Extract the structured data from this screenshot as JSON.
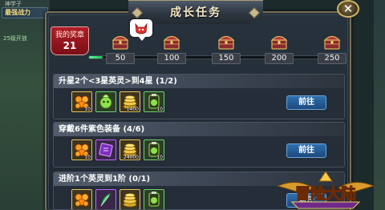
{
  "background": {
    "top_text": "神学子",
    "power_label": "最强战力",
    "hint_text": "25级开放"
  },
  "window": {
    "title": "成长任务",
    "close_symbol": "✕"
  },
  "medal": {
    "label": "我的奖章",
    "value": "21"
  },
  "progress": {
    "current": 21,
    "max": 250,
    "milestones": [
      {
        "value": "50",
        "icon": "chest-icon"
      },
      {
        "value": "100",
        "icon": "chest-icon"
      },
      {
        "value": "150",
        "icon": "chest-icon"
      },
      {
        "value": "200",
        "icon": "chest-icon"
      },
      {
        "value": "250",
        "icon": "chest-icon"
      }
    ]
  },
  "tasks": [
    {
      "title": "升星2个<3星英灵>到4星 (1/2)",
      "button": "前往",
      "rewards": [
        {
          "icon": "orange-gems-icon",
          "count": "10",
          "rarity": "gold"
        },
        {
          "icon": "green-spirit-icon",
          "count": "",
          "rarity": "green"
        },
        {
          "icon": "gold-coins-icon",
          "count": "1400",
          "rarity": "gold"
        },
        {
          "icon": "green-potion-icon",
          "count": "10",
          "rarity": "green"
        }
      ]
    },
    {
      "title": "穿戴6件紫色装备 (4/6)",
      "button": "前往",
      "rewards": [
        {
          "icon": "orange-gems-icon",
          "count": "10",
          "rarity": "gold"
        },
        {
          "icon": "purple-scroll-icon",
          "count": "",
          "rarity": "purple"
        },
        {
          "icon": "gold-coins-icon",
          "count": "24000",
          "rarity": "gold"
        },
        {
          "icon": "green-potion-icon",
          "count": "10",
          "rarity": "green"
        }
      ]
    },
    {
      "title": "进阶1个英灵到1阶 (0/1)",
      "button": "前往",
      "rewards": [
        {
          "icon": "orange-gems-icon",
          "count": "",
          "rarity": "gold"
        },
        {
          "icon": "feather-icon",
          "count": "",
          "rarity": "purple"
        },
        {
          "icon": "gold-coins-icon",
          "count": "",
          "rarity": "gold"
        },
        {
          "icon": "green-potion-icon",
          "count": "",
          "rarity": "green"
        }
      ]
    }
  ],
  "logo": {
    "text": "冒险大陆"
  },
  "colors": {
    "medal_red": "#b21e28",
    "progress_green": "#20b85e",
    "button_blue": "#2f6fae",
    "panel_dark": "#252d38"
  }
}
